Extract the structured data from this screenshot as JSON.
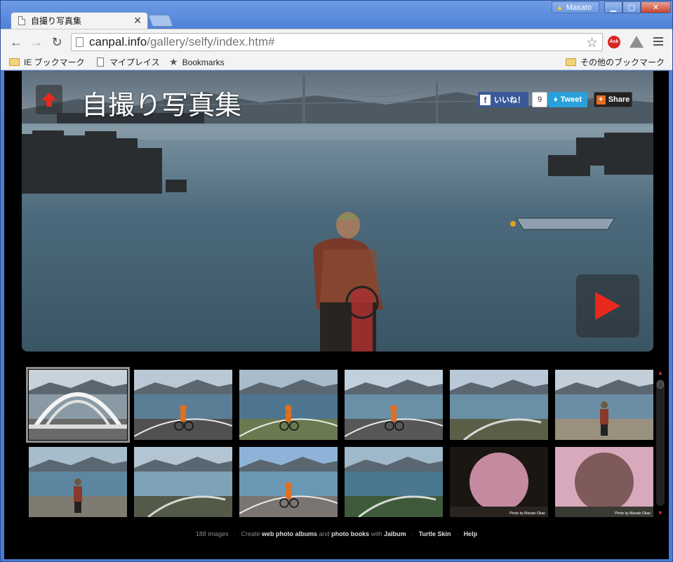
{
  "browser": {
    "tab_title": "自撮り写真集",
    "tab_close": "✕",
    "user_name": "Masato",
    "url_host": "canpal.info",
    "url_path": "/gallery/selfy/index.htm#",
    "ext_ask_label": "Ask",
    "bookmarks": [
      {
        "label": "IE ブックマーク"
      },
      {
        "label": "マイプレイス"
      },
      {
        "label": "Bookmarks"
      }
    ],
    "other_bookmarks": "その他のブックマーク"
  },
  "colors": {
    "accent_red": "#e8291c",
    "facebook": "#3b5998",
    "twitter": "#29a0da",
    "share_orange": "#e86a20"
  },
  "gallery": {
    "title": "自撮り写真集",
    "social": {
      "like_label": "いいね！",
      "like_count": "9",
      "tweet_label": "Tweet",
      "share_label": "Share"
    },
    "thumbnails": [
      {
        "scene": "bridge",
        "selected": true
      },
      {
        "scene": "coast-road-cyclist"
      },
      {
        "scene": "sea-cyclist"
      },
      {
        "scene": "curve-road-cyclist"
      },
      {
        "scene": "island-road"
      },
      {
        "scene": "beach-standing"
      },
      {
        "scene": "sitting-by-bike"
      },
      {
        "scene": "coast-path"
      },
      {
        "scene": "bridge-bay-cyclist"
      },
      {
        "scene": "causeway"
      },
      {
        "scene": "blossom-tunnel",
        "credit": "Photo by Masato Okan"
      },
      {
        "scene": "blossom-tunnel-cyclist",
        "credit": "Photo by Masato Okan"
      }
    ]
  },
  "footer": {
    "count": "188 images",
    "create_prefix": "Create",
    "link1": "web photo albums",
    "and_text": "and",
    "link2": "photo books",
    "with_text": "with",
    "link3": "Jalbum",
    "link4": "Turtle Skin",
    "link5": "Help",
    "separator": "·"
  }
}
